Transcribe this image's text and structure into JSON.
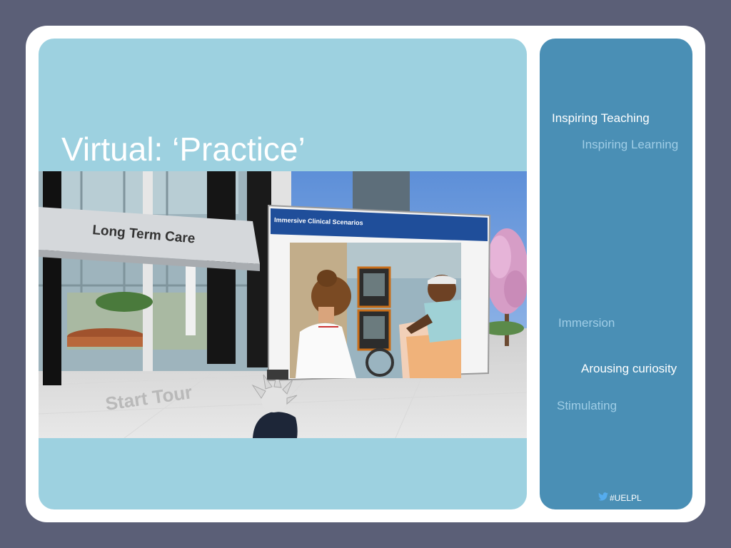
{
  "slide": {
    "title": "Virtual: ‘Practice’"
  },
  "photo": {
    "sign_text": "Long Term Care",
    "screen_title": "Immersive Clinical Scenarios",
    "floor_text": "Start Tour"
  },
  "sidebar": {
    "phrases": [
      "Inspiring Teaching",
      "Inspiring Learning",
      "Immersion",
      "Arousing curiosity",
      "Stimulating"
    ],
    "hashtag": "#UELPL",
    "hashtag_icon": "twitter-bird-icon"
  },
  "colors": {
    "background": "#5b5f77",
    "frame": "#ffffff",
    "left_panel": "#9dd1e0",
    "right_panel": "#4a8fb5",
    "phrase_light": "#9fcde6"
  }
}
